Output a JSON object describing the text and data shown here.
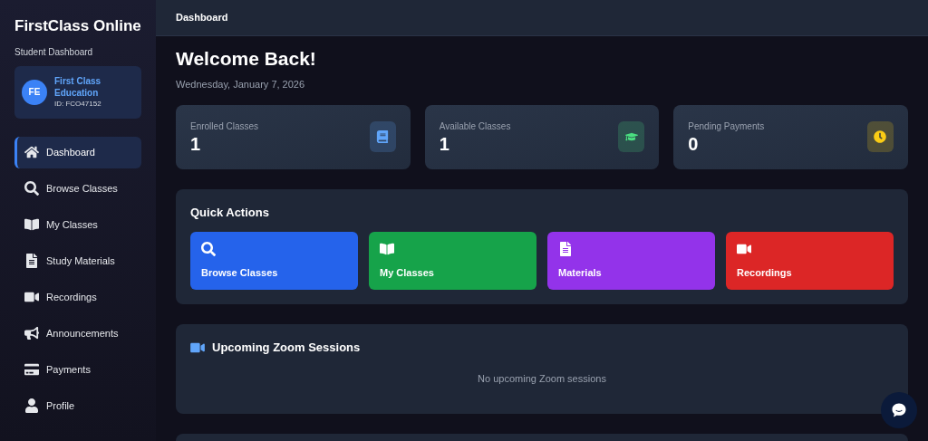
{
  "sidebar": {
    "title": "FirstClass Online",
    "subtitle": "Student Dashboard",
    "profile": {
      "initials": "FE",
      "name": "First Class Education",
      "id": "ID: FCO47152"
    },
    "items": [
      {
        "label": "Dashboard",
        "kind": "home",
        "selected": true
      },
      {
        "label": "Browse Classes",
        "kind": "search",
        "selected": false
      },
      {
        "label": "My Classes",
        "kind": "book-open",
        "selected": false
      },
      {
        "label": "Study Materials",
        "kind": "file",
        "selected": false
      },
      {
        "label": "Recordings",
        "kind": "video",
        "selected": false
      },
      {
        "label": "Announcements",
        "kind": "bullhorn",
        "selected": false
      },
      {
        "label": "Payments",
        "kind": "card",
        "selected": false
      },
      {
        "label": "Profile",
        "kind": "user",
        "selected": false
      }
    ]
  },
  "header": {
    "title": "Dashboard"
  },
  "welcome": {
    "title": "Welcome Back!",
    "date": "Wednesday, January 7, 2026"
  },
  "stats": [
    {
      "label": "Enrolled Classes",
      "value": "1",
      "kind": "book",
      "color": "#60a5fa"
    },
    {
      "label": "Available Classes",
      "value": "1",
      "kind": "graduation",
      "color": "#4ade80"
    },
    {
      "label": "Pending Payments",
      "value": "0",
      "kind": "clock",
      "color": "#facc15"
    }
  ],
  "quick_actions": {
    "title": "Quick Actions",
    "items": [
      {
        "label": "Browse Classes",
        "kind": "search",
        "color": "#2563eb"
      },
      {
        "label": "My Classes",
        "kind": "book-open",
        "color": "#16a34a"
      },
      {
        "label": "Materials",
        "kind": "file",
        "color": "#9333ea"
      },
      {
        "label": "Recordings",
        "kind": "video",
        "color": "#dc2626"
      }
    ]
  },
  "zoom_sessions": {
    "title": "Upcoming Zoom Sessions",
    "empty": "No upcoming Zoom sessions"
  }
}
